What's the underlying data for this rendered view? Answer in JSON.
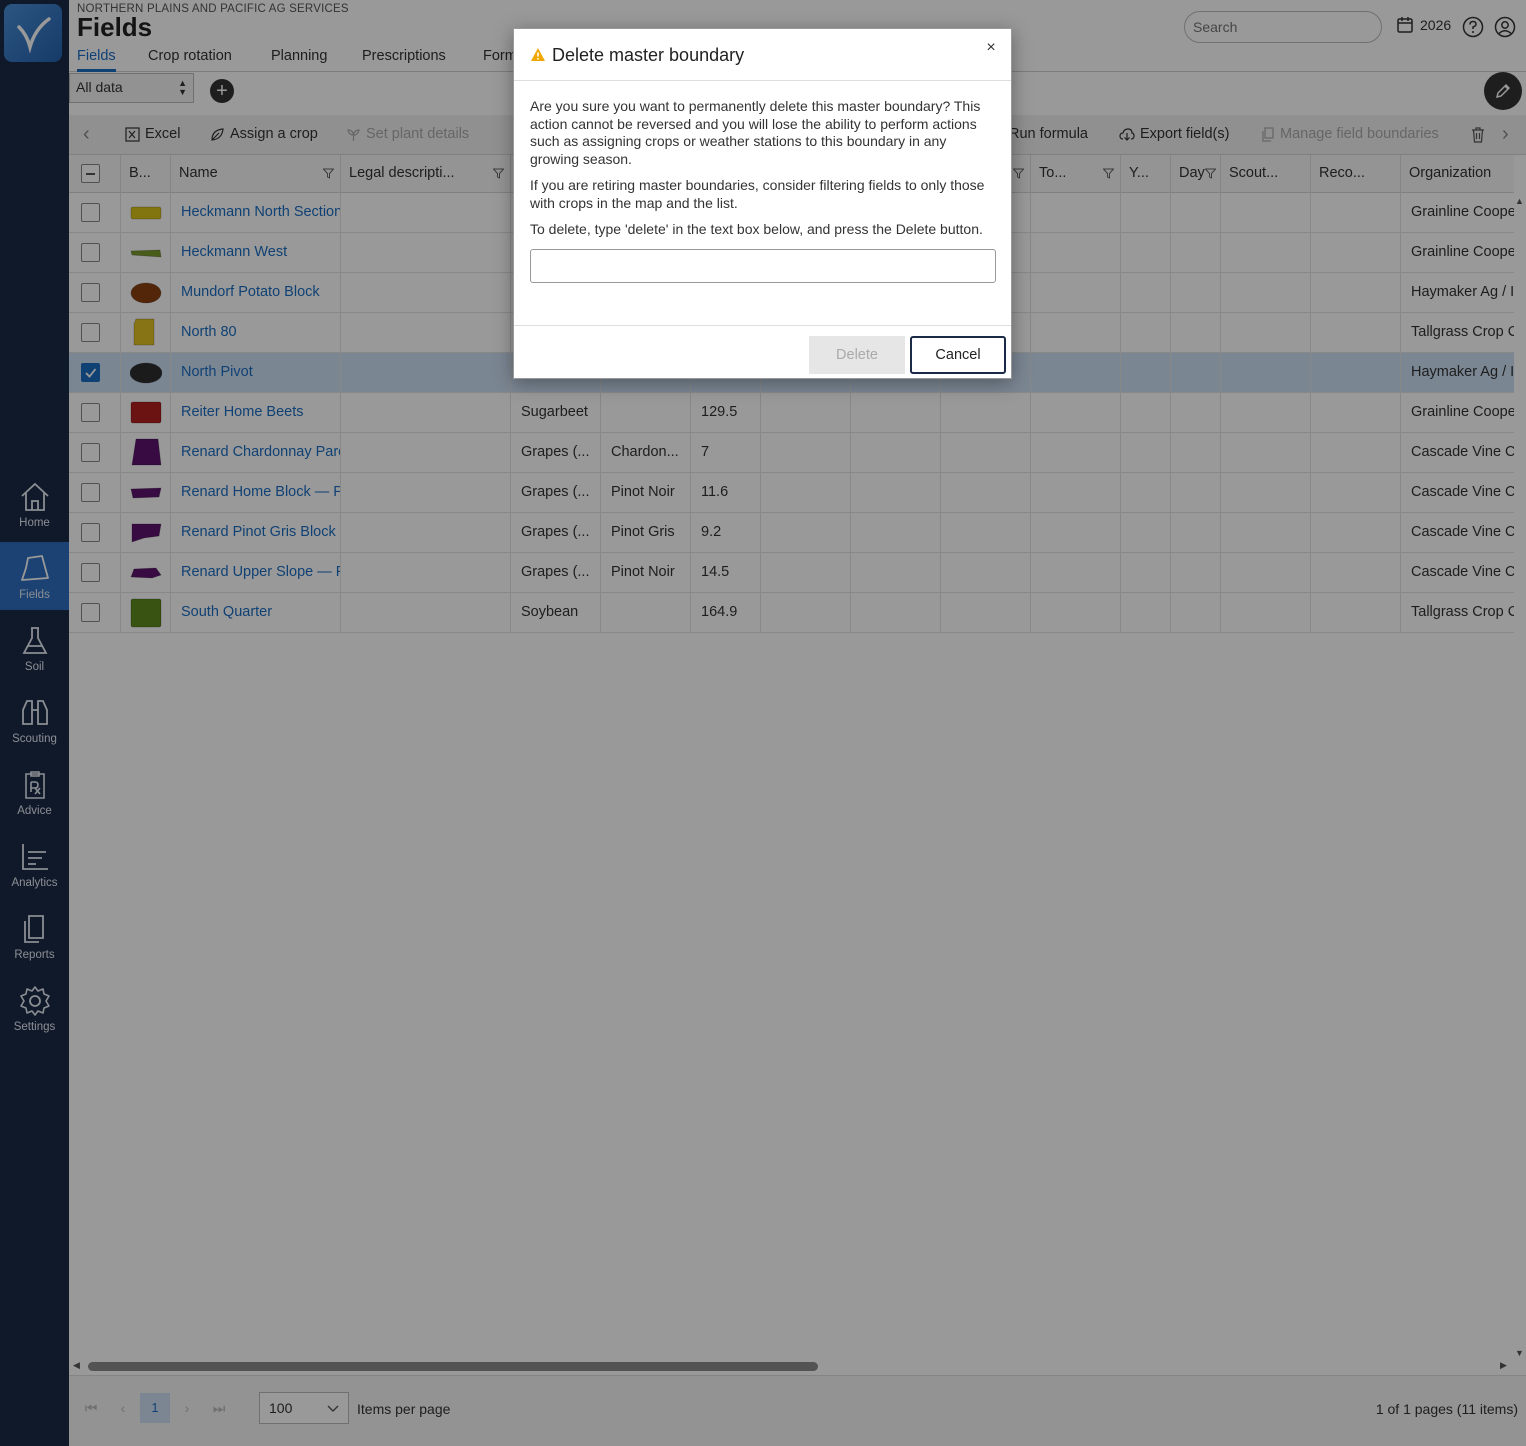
{
  "org_name": "NORTHERN PLAINS AND PACIFIC AG SERVICES",
  "page_title": "Fields",
  "header": {
    "search_placeholder": "Search",
    "year": "2026"
  },
  "tabs": [
    "Fields",
    "Crop rotation",
    "Planning",
    "Prescriptions",
    "Form"
  ],
  "data_filter": "All data",
  "sidebar": [
    "Home",
    "Fields",
    "Soil",
    "Scouting",
    "Advice",
    "Analytics",
    "Reports",
    "Settings"
  ],
  "toolbar": {
    "excel": "Excel",
    "assign_crop": "Assign a crop",
    "set_plant_details": "Set plant details",
    "run_formula": "Run formula",
    "export": "Export field(s)",
    "manage_boundaries": "Manage field boundaries"
  },
  "columns": [
    "B...",
    "Name",
    "Legal descripti...",
    "To...",
    "Y...",
    "Day",
    "Scout...",
    "Reco...",
    "Organization"
  ],
  "rows": [
    {
      "name": "Heckmann North Section",
      "crop": "",
      "variety": "",
      "acres": "",
      "org": "Grainline Cooperative",
      "color": "#d9c21a",
      "selected": false
    },
    {
      "name": "Heckmann West",
      "crop": "",
      "variety": "",
      "acres": "",
      "org": "Grainline Cooperative",
      "color": "#7a9a2c",
      "selected": false
    },
    {
      "name": "Mundorf Potato Block",
      "crop": "",
      "variety": "",
      "acres": "",
      "org": "Haymaker Ag / Irrigation",
      "color": "#8a4010",
      "selected": false
    },
    {
      "name": "North 80",
      "crop": "",
      "variety": "",
      "acres": "",
      "org": "Tallgrass Crop Consulting",
      "color": "#e2c224",
      "selected": false
    },
    {
      "name": "North Pivot",
      "crop": "",
      "variety": "",
      "acres": "",
      "org": "Haymaker Ag / Irrigation",
      "color": "#2e2e2e",
      "selected": true
    },
    {
      "name": "Reiter Home Beets",
      "crop": "Sugarbeet",
      "variety": "",
      "acres": "129.5",
      "org": "Grainline Cooperative",
      "color": "#b21e1e",
      "selected": false
    },
    {
      "name": "Renard Chardonnay Parcel",
      "crop": "Grapes (...",
      "variety": "Chardon...",
      "acres": "7",
      "org": "Cascade Vine Co",
      "color": "#5e1470",
      "selected": false
    },
    {
      "name": "Renard Home Block — Pinot Noir",
      "crop": "Grapes (...",
      "variety": "Pinot Noir",
      "acres": "11.6",
      "org": "Cascade Vine Co",
      "color": "#5e1470",
      "selected": false
    },
    {
      "name": "Renard Pinot Gris Block",
      "crop": "Grapes (...",
      "variety": "Pinot Gris",
      "acres": "9.2",
      "org": "Cascade Vine Co",
      "color": "#5e1470",
      "selected": false
    },
    {
      "name": "Renard Upper Slope — Pinot Noir",
      "crop": "Grapes (...",
      "variety": "Pinot Noir",
      "acres": "14.5",
      "org": "Cascade Vine Co",
      "color": "#5e1470",
      "selected": false
    },
    {
      "name": "South Quarter",
      "crop": "Soybean",
      "variety": "",
      "acres": "164.9",
      "org": "Tallgrass Crop Consulting",
      "color": "#5e8a1e",
      "selected": false
    }
  ],
  "pager": {
    "current_page": "1",
    "page_size": "100",
    "items_per_page": "Items per page",
    "summary": "1 of 1 pages (11 items)"
  },
  "modal": {
    "title": "Delete master boundary",
    "paragraph1": "Are you sure you want to permanently delete this master boundary? This action cannot be reversed and you will lose the ability to perform actions such as assigning crops or weather stations to this boundary in any growing season.",
    "paragraph2": "If you are retiring master boundaries, consider filtering fields to only those with crops in the map and the list.",
    "paragraph3": "To delete, type 'delete' in the text box below, and press the Delete button.",
    "input_value": "",
    "delete_label": "Delete",
    "cancel_label": "Cancel",
    "close_glyph": "×"
  },
  "colors": {
    "sidebar": "#1b2a47",
    "accent": "#1b6dc1",
    "warning": "#f0a800"
  }
}
